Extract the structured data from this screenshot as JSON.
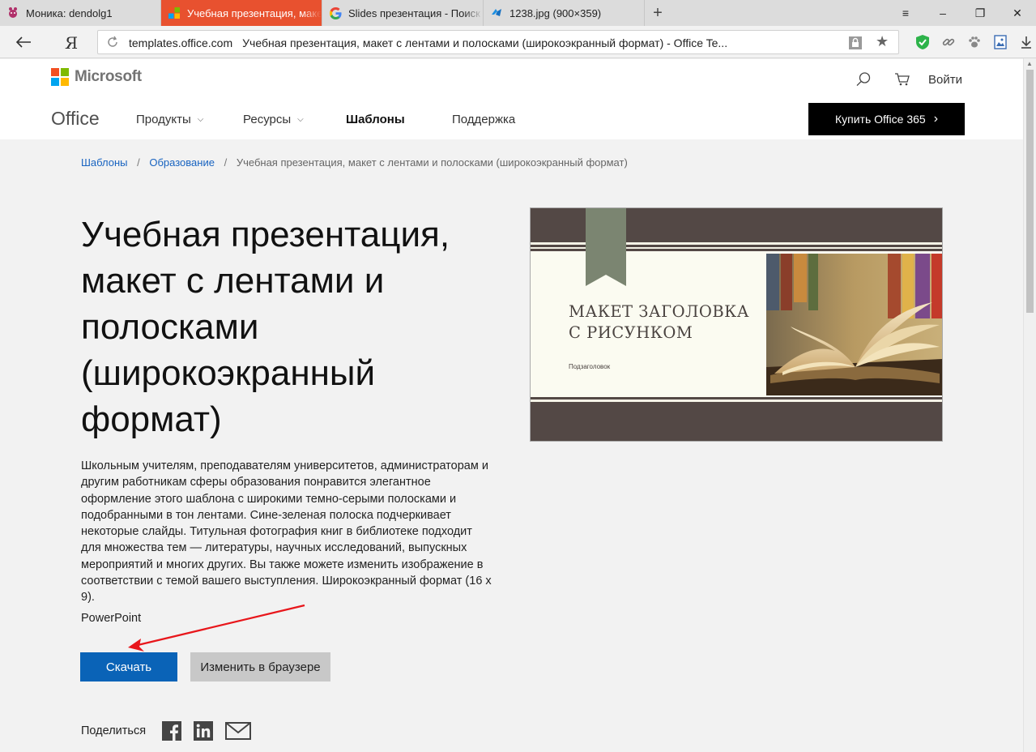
{
  "browser": {
    "tabs": [
      {
        "label": "Моника: dendolg1",
        "icon": "monika-favicon",
        "active": false
      },
      {
        "label": "Учебная презентация, макет",
        "icon": "office-favicon",
        "active": true
      },
      {
        "label": "Slides презентация - Поиск",
        "icon": "google-favicon",
        "active": false
      },
      {
        "label": "1238.jpg (900×359)",
        "icon": "image-favicon",
        "active": false
      }
    ],
    "new_tab_glyph": "+",
    "window_controls": {
      "menu": "≡",
      "minimize": "–",
      "restore": "❐",
      "close": "✕"
    },
    "yandex_glyph": "Я",
    "url_host": "templates.office.com",
    "url_title": "Учебная презентация, макет с лентами и полосками (широкоэкранный формат) - Office Te...",
    "star_glyph": "★"
  },
  "header": {
    "logo_text": "Microsoft",
    "logo_colors": [
      "#f25022",
      "#7fba00",
      "#00a4ef",
      "#ffb900"
    ],
    "login": "Войти",
    "office_brand": "Office",
    "nav": [
      {
        "label": "Продукты",
        "has_chevron": true
      },
      {
        "label": "Ресурсы",
        "has_chevron": true
      },
      {
        "label": "Шаблоны",
        "has_chevron": false
      },
      {
        "label": "Поддержка",
        "has_chevron": false
      }
    ],
    "chevron_glyph": "⌵",
    "buy_button": "Купить Office 365",
    "buy_arrow": "›"
  },
  "breadcrumb": {
    "items": [
      "Шаблоны",
      "Образование"
    ],
    "current": "Учебная презентация, макет с лентами и полосками (широкоэкранный формат)",
    "separator": "/"
  },
  "content": {
    "title": "Учебная презентация, макет с лентами и полосками (широкоэкранный формат)",
    "description": "Школьным учителям, преподавателям университетов, администраторам и другим работникам сферы образования понравится элегантное оформление этого шаблона с широкими темно-серыми полосками и подобранными в тон лентами. Сине-зеленая полоска подчеркивает некоторые слайды. Титульная фотография книг в библиотеке подходит для множества тем — литературы, научных исследований, выпускных мероприятий и многих других. Вы также можете изменить изображение в соответствии с темой вашего выступления. Широкоэкранный формат (16 x 9).",
    "app": "PowerPoint",
    "download_button": "Скачать",
    "edit_button": "Изменить в браузере",
    "share_label": "Поделиться",
    "accent_color": "#0a63b7"
  },
  "preview": {
    "slide_title_line1": "МАКЕТ ЗАГОЛОВКА",
    "slide_title_line2": "С РИСУНКОМ",
    "slide_subtitle": "Подзаголовок",
    "band_color": "#534845",
    "ribbon_color": "#7b8571"
  },
  "annotation": {
    "arrow_color": "#e8161b"
  }
}
